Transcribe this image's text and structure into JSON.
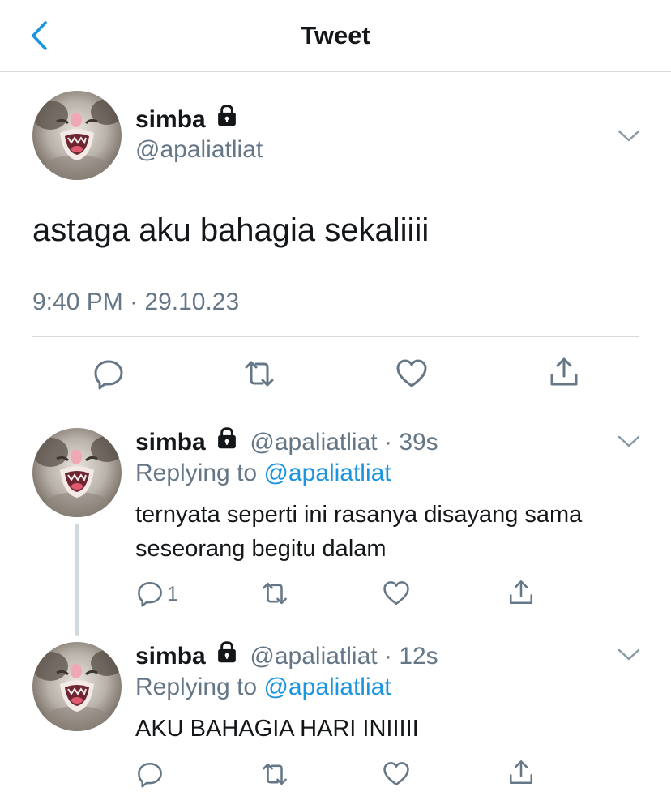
{
  "header": {
    "title": "Tweet",
    "back_icon": "chevron-left-icon"
  },
  "main_tweet": {
    "display_name": "simba",
    "handle": "@apaliatliat",
    "text": "astaga aku bahagia sekaliiii",
    "timestamp": "9:40 PM · 29.10.23",
    "actions": [
      "reply-icon",
      "retweet-icon",
      "like-icon",
      "share-icon"
    ]
  },
  "replies": [
    {
      "display_name": "simba",
      "handle": "@apaliatliat",
      "separator": "·",
      "time": "39s",
      "replying_prefix": "Replying to",
      "replying_to": "@apaliatliat",
      "text_line1": "ternyata seperti ini rasanya disayang sama",
      "text_line2": "seseorang begitu dalam",
      "reply_count": "1"
    },
    {
      "display_name": "simba",
      "handle": "@apaliatliat",
      "separator": "·",
      "time": "12s",
      "replying_prefix": "Replying to",
      "replying_to": "@apaliatliat",
      "text_line1": "AKU BAHAGIA HARI INIIIII"
    }
  ],
  "colors": {
    "accent": "#1b95e0",
    "muted": "#657786",
    "divider": "#d6d9db"
  }
}
